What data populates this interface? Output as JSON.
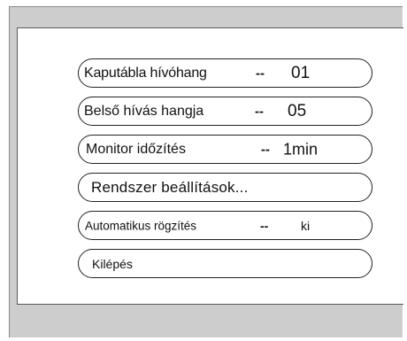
{
  "menu": {
    "items": [
      {
        "label": "Kaputábla hívóhang",
        "separator": "--",
        "value": "01"
      },
      {
        "label": "Belső hívás hangja",
        "separator": "--",
        "value": "05"
      },
      {
        "label": "Monitor időzítés",
        "separator": "--",
        "value": "1min"
      },
      {
        "label": "Rendszer beállítások..."
      },
      {
        "label": "Automatikus rögzítés",
        "separator": "--",
        "value": "ki"
      },
      {
        "label": "Kilépés"
      }
    ]
  }
}
